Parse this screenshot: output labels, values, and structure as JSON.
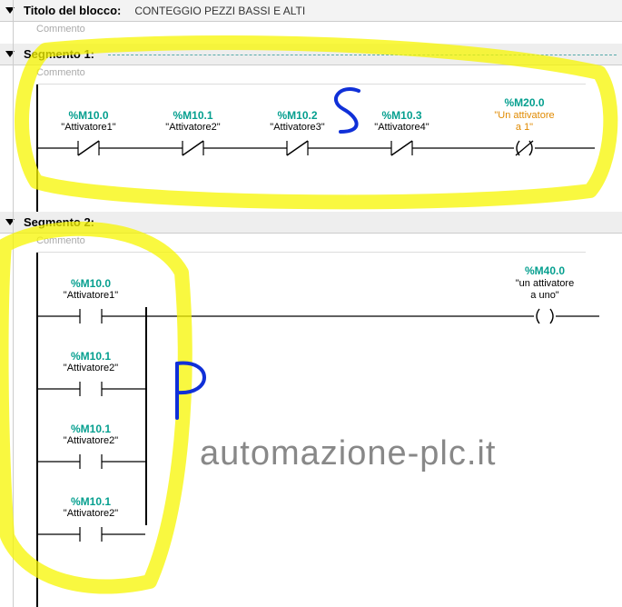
{
  "title_label": "Titolo del blocco:",
  "title_value": "CONTEGGIO PEZZI BASSI E ALTI",
  "comment_label": "Commento",
  "segments": [
    {
      "name": "Segmento 1:",
      "comment": "Commento",
      "rungs": {
        "serial": [
          {
            "address": "%M10.0",
            "symbol": "\"Attivatore1\"",
            "type": "NC"
          },
          {
            "address": "%M10.1",
            "symbol": "\"Attivatore2\"",
            "type": "NC"
          },
          {
            "address": "%M10.2",
            "symbol": "\"Attivatore3\"",
            "type": "NC"
          },
          {
            "address": "%M10.3",
            "symbol": "\"Attivatore4\"",
            "type": "NC"
          }
        ],
        "coil": {
          "address": "%M20.0",
          "symbol_lines": [
            "\"Un attivatore",
            "a 1\""
          ],
          "type": "NC_coil",
          "color": "orange"
        }
      }
    },
    {
      "name": "Segmento 2:",
      "comment": "Commento",
      "rungs": {
        "parallel": [
          {
            "address": "%M10.0",
            "symbol": "\"Attivatore1\"",
            "type": "NO"
          },
          {
            "address": "%M10.1",
            "symbol": "\"Attivatore2\"",
            "type": "NO"
          },
          {
            "address": "%M10.1",
            "symbol": "\"Attivatore2\"",
            "type": "NO"
          },
          {
            "address": "%M10.1",
            "symbol": "\"Attivatore2\"",
            "type": "NO"
          }
        ],
        "coil": {
          "address": "%M40.0",
          "symbol_lines": [
            "\"un attivatore",
            "a uno\""
          ],
          "type": "coil"
        }
      }
    }
  ],
  "watermark": "automazione-plc.it",
  "annotations": {
    "letter1": "S",
    "letter2": "P"
  }
}
